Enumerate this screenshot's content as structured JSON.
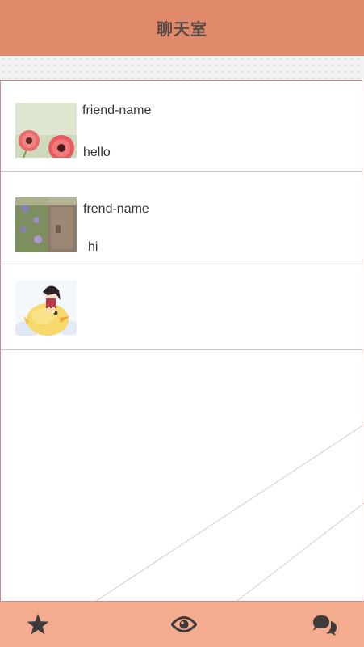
{
  "header": {
    "title": "聊天室"
  },
  "chats": [
    {
      "name": "friend-name",
      "message": "hello",
      "avatar": "pink-flowers-photo"
    },
    {
      "name": "frend-name",
      "message": "hi",
      "avatar": "garden-gate-photo"
    },
    {
      "name": "",
      "message": "",
      "avatar": "cartoon-girl-on-chick"
    }
  ],
  "footer": {
    "icons": [
      "star-icon",
      "eye-icon",
      "chat-bubbles-icon"
    ]
  },
  "colors": {
    "header": "#e08a6b",
    "footer": "#f3ad8e",
    "panel_border": "#d9868f",
    "divider": "#c8c8c8"
  }
}
